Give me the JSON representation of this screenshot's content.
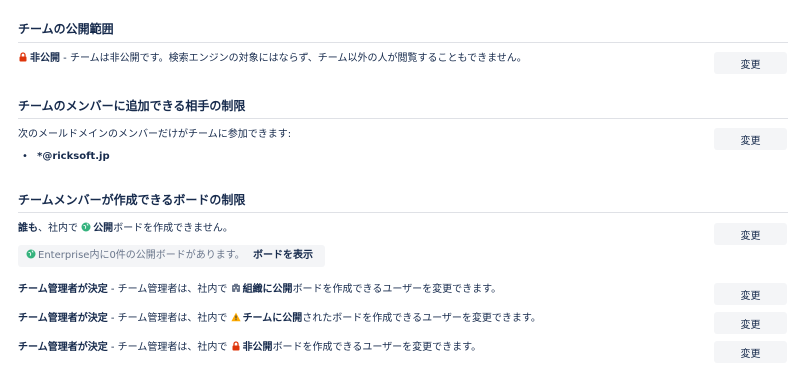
{
  "section1": {
    "title": "チームの公開範囲",
    "private_label": "非公開",
    "private_desc": " - チームは非公開です。検索エンジンの対象にはならず、チーム以外の人が閲覧することもできません。",
    "change_label": "変更"
  },
  "section2": {
    "title": "チームのメンバーに追加できる相手の制限",
    "desc": "次のメールドメインのメンバーだけがチームに参加できます:",
    "domain": "*@ricksoft.jp",
    "change_label": "変更"
  },
  "section3": {
    "title": "チームメンバーが作成できるボードの制限",
    "row_main": {
      "who": "誰も",
      "mid": "、社内で ",
      "scope": "公開",
      "tail": "ボードを作成できません。",
      "change_label": "変更"
    },
    "banner": {
      "text": "Enterprise内に0件の公開ボードがあります。",
      "link": "ボードを表示"
    },
    "rows": [
      {
        "who": "チーム管理者が決定",
        "pre": " - チーム管理者は、社内で ",
        "scope": "組織に公開",
        "post": "ボードを作成できるユーザーを変更できます。",
        "change_label": "変更"
      },
      {
        "who": "チーム管理者が決定",
        "pre": " - チーム管理者は、社内で ",
        "scope": "チームに公開",
        "post": "されたボードを作成できるユーザーを変更できます。",
        "change_label": "変更"
      },
      {
        "who": "チーム管理者が決定",
        "pre": " - チーム管理者は、社内で ",
        "scope": "非公開",
        "post": "ボードを作成できるユーザーを変更できます。",
        "change_label": "変更"
      }
    ]
  },
  "icons": {
    "lock": "lock-icon",
    "globe": "globe-icon",
    "building": "building-icon",
    "team": "team-warning-icon"
  },
  "colors": {
    "text": "#172b4d",
    "muted": "#6b778c",
    "button_bg": "#f4f5f7",
    "lock_red": "#de350b",
    "globe_green": "#36b37e",
    "warn_yellow": "#ffab00",
    "divider": "#dfe1e6"
  }
}
